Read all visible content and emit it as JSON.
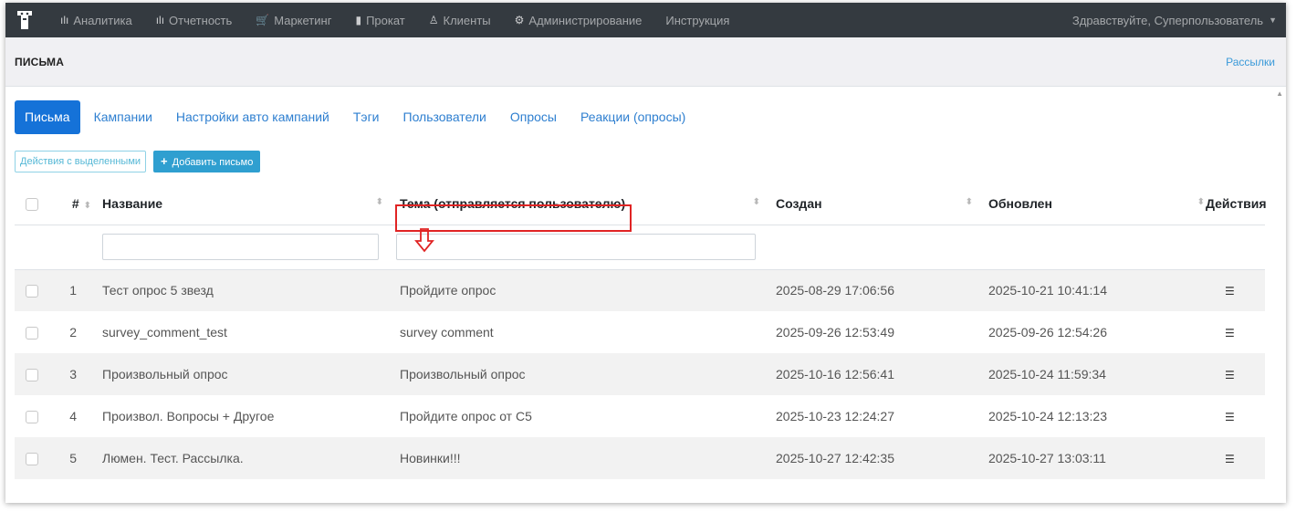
{
  "navbar": {
    "items": [
      {
        "icon": "bar-chart-icon",
        "glyph": "ılı",
        "label": "Аналитика"
      },
      {
        "icon": "bar-chart-icon",
        "glyph": "ılı",
        "label": "Отчетность"
      },
      {
        "icon": "cart-icon",
        "glyph": "🛒",
        "label": "Маркетинг"
      },
      {
        "icon": "film-icon",
        "glyph": "▮",
        "label": "Прокат"
      },
      {
        "icon": "user-icon",
        "glyph": "♙",
        "label": "Клиенты"
      },
      {
        "icon": "gears-icon",
        "glyph": "⚙",
        "label": "Администрирование"
      },
      {
        "icon": "",
        "glyph": "",
        "label": "Инструкция"
      }
    ],
    "user_greeting": "Здравствуйте, Суперпользователь"
  },
  "page": {
    "title": "ПИСЬМА",
    "right_link": "Рассылки"
  },
  "tabs": [
    "Письма",
    "Кампании",
    "Настройки авто кампаний",
    "Тэги",
    "Пользователи",
    "Опросы",
    "Реакции (опросы)"
  ],
  "toolbar": {
    "bulk_actions_label": "Действия с выделенными",
    "add_label": "Добавить письмо"
  },
  "table": {
    "headers": {
      "num": "#",
      "name": "Название",
      "subject": "Тема (отправляется пользователю)",
      "created": "Создан",
      "updated": "Обновлен",
      "actions": "Действия"
    },
    "rows": [
      {
        "num": "1",
        "name": "Тест опрос 5 звезд",
        "subject": "Пройдите опрос",
        "created": "2025-08-29 17:06:56",
        "updated": "2025-10-21 10:41:14"
      },
      {
        "num": "2",
        "name": "survey_comment_test",
        "subject": "survey comment",
        "created": "2025-09-26 12:53:49",
        "updated": "2025-09-26 12:54:26"
      },
      {
        "num": "3",
        "name": "Произвольный опрос",
        "subject": "Произвольный опрос",
        "created": "2025-10-16 12:56:41",
        "updated": "2025-10-24 11:59:34"
      },
      {
        "num": "4",
        "name": "Произвол. Вопросы + Другое",
        "subject": "Пройдите опрос от C5",
        "created": "2025-10-23 12:24:27",
        "updated": "2025-10-24 12:13:23"
      },
      {
        "num": "5",
        "name": "Люмен. Тест. Рассылка.",
        "subject": "Новинки!!!",
        "created": "2025-10-27 12:42:35",
        "updated": "2025-10-27 13:03:11"
      }
    ]
  },
  "colors": {
    "navbar_bg": "#343a40",
    "active_tab": "#1572d8",
    "link": "#2e7fd0",
    "highlight": "#e02424"
  }
}
